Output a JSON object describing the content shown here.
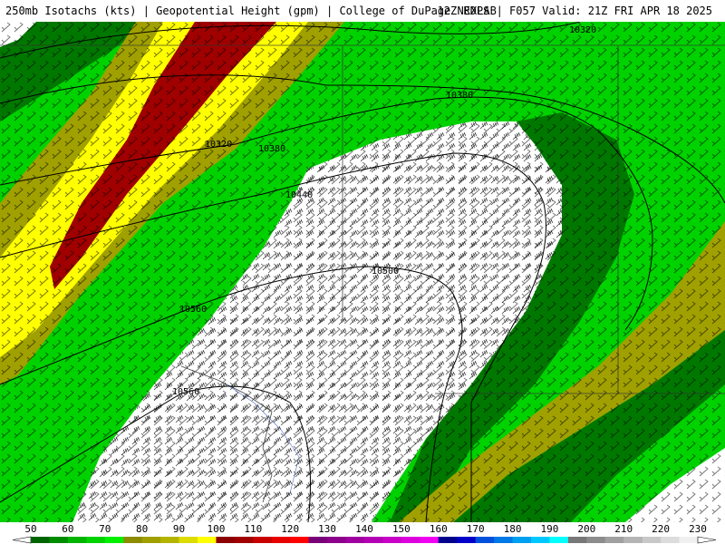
{
  "header": {
    "left_text": "250mb Isotachs (kts) | Geopotential Height (gpm) | College of DuPage NEXLAB",
    "right_text": "12Z RDPS | F057 Valid: 21Z FRI APR 18 2025"
  },
  "contour_labels": [
    "10320",
    "10380",
    "10320",
    "10380",
    "10440",
    "10500",
    "10560",
    "10560"
  ],
  "legend": {
    "ticks": [
      "50",
      "60",
      "70",
      "80",
      "90",
      "100",
      "110",
      "120",
      "130",
      "140",
      "150",
      "160",
      "170",
      "180",
      "190",
      "200",
      "210",
      "220",
      "230"
    ],
    "colors": [
      "#006400",
      "#008c00",
      "#00b400",
      "#00d200",
      "#00f000",
      "#8c8c00",
      "#a0a000",
      "#b4b400",
      "#dcdc00",
      "#ffff00",
      "#8c0000",
      "#a00000",
      "#c80000",
      "#e60000",
      "#ff0000",
      "#780078",
      "#8c008c",
      "#a000a0",
      "#b400b4",
      "#c800c8",
      "#dc00dc",
      "#f000f0",
      "#00008c",
      "#0000c8",
      "#0050dc",
      "#0078e6",
      "#00a0f0",
      "#00c8ff",
      "#00ffff",
      "#787878",
      "#8c8c8c",
      "#a0a0a0",
      "#b4b4b4",
      "#c8c8c8",
      "#dcdcdc",
      "#f0f0f0"
    ]
  },
  "colors": {
    "speed_50_70": "#007800",
    "speed_70_90": "#00c800",
    "speed_90_100": "#a0a000",
    "speed_100_120": "#ffff00",
    "speed_120_plus": "#a00000"
  }
}
